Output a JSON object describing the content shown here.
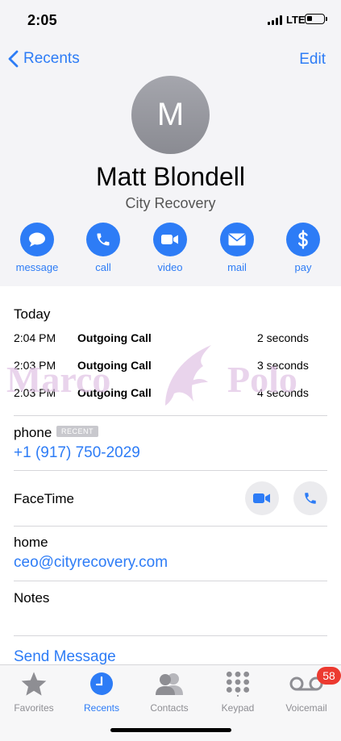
{
  "status_bar": {
    "time": "2:05",
    "network": "LTE",
    "battery_level": 0.35
  },
  "nav": {
    "back_label": "Recents",
    "edit_label": "Edit"
  },
  "contact": {
    "initial": "M",
    "name": "Matt Blondell",
    "company": "City Recovery"
  },
  "actions": [
    {
      "label": "message",
      "icon": "message-icon"
    },
    {
      "label": "call",
      "icon": "phone-icon"
    },
    {
      "label": "video",
      "icon": "video-icon"
    },
    {
      "label": "mail",
      "icon": "mail-icon"
    },
    {
      "label": "pay",
      "icon": "dollar-icon"
    }
  ],
  "calls": {
    "heading": "Today",
    "rows": [
      {
        "time": "2:04 PM",
        "kind": "Outgoing Call",
        "duration": "2 seconds"
      },
      {
        "time": "2:03 PM",
        "kind": "Outgoing Call",
        "duration": "3 seconds"
      },
      {
        "time": "2:03 PM",
        "kind": "Outgoing Call",
        "duration": "4 seconds"
      }
    ]
  },
  "watermark": {
    "text_left": "Marco",
    "text_right": "Polo",
    "color": "#e2c6e6"
  },
  "phone": {
    "label": "phone",
    "badge": "RECENT",
    "number": "+1 (917) 750-2029"
  },
  "facetime": {
    "label": "FaceTime"
  },
  "email": {
    "label": "home",
    "address": "ceo@cityrecovery.com"
  },
  "notes": {
    "label": "Notes"
  },
  "send_message": "Send Message",
  "tabbar": {
    "tabs": [
      {
        "label": "Favorites",
        "icon": "star-icon"
      },
      {
        "label": "Recents",
        "icon": "clock-icon",
        "active": true
      },
      {
        "label": "Contacts",
        "icon": "contacts-icon"
      },
      {
        "label": "Keypad",
        "icon": "keypad-icon"
      },
      {
        "label": "Voicemail",
        "icon": "voicemail-icon"
      }
    ],
    "voicemail_badge": "58"
  },
  "colors": {
    "accent": "#2d7cf6",
    "badge": "#ec3a30"
  }
}
